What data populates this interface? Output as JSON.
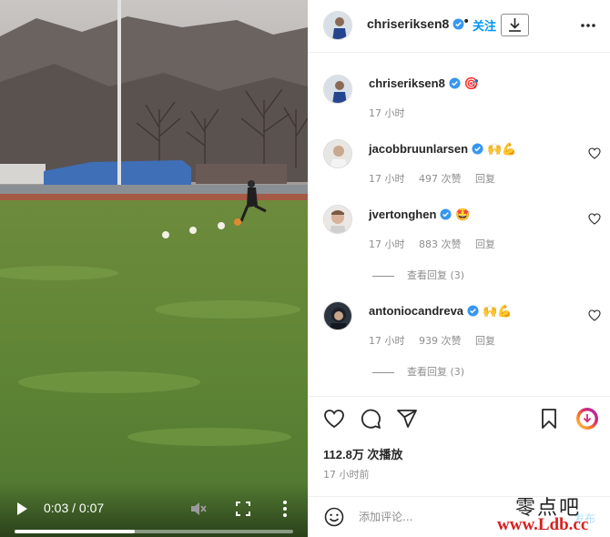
{
  "video": {
    "time": "0:03 / 0:07",
    "progress": 0.43
  },
  "header": {
    "username": "chriseriksen8",
    "dot": "•",
    "follow_label": "关注"
  },
  "caption": {
    "username": "chriseriksen8",
    "emoji": "🎯",
    "time": "17 小时"
  },
  "comments": [
    {
      "username": "jacobbruunlarsen",
      "verified": true,
      "emoji": "🙌💪",
      "time": "17 小时",
      "likes": "497 次赞",
      "reply_label": "回复",
      "view_replies": ""
    },
    {
      "username": "jvertonghen",
      "verified": true,
      "emoji": "🤩",
      "time": "17 小时",
      "likes": "883 次赞",
      "reply_label": "回复",
      "view_replies": "查看回复 (3)"
    },
    {
      "username": "antoniocandreva",
      "verified": true,
      "emoji": "🙌💪",
      "time": "17 小时",
      "likes": "939 次赞",
      "reply_label": "回复",
      "view_replies": "查看回复 (3)"
    }
  ],
  "stats": {
    "plays": "112.8万 次播放",
    "posted": "17 小时前"
  },
  "comment_box": {
    "placeholder": "添加评论...",
    "post_label": "发布"
  },
  "watermark": {
    "site_cn": "零点吧",
    "site_url": "www.Ldb.cc"
  },
  "colors": {
    "accent": "#0095f6",
    "verified": "#3897f0",
    "muted": "#8e8e8e"
  }
}
